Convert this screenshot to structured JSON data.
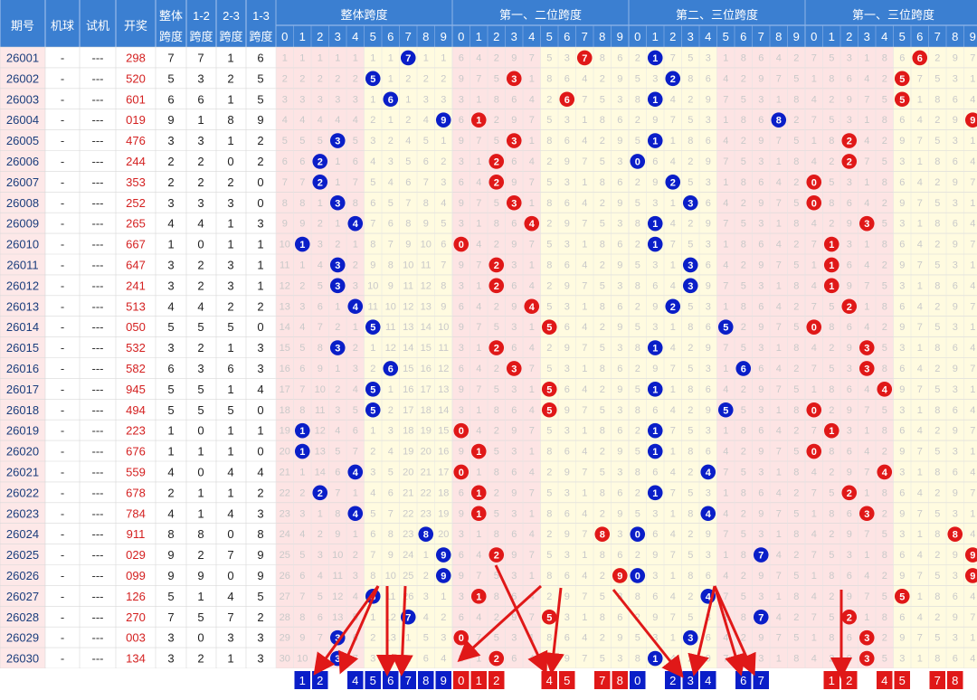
{
  "header": {
    "columns": [
      "期号",
      "机球",
      "试机",
      "开奖",
      "整体跨度",
      "1-2跨度",
      "2-3跨度",
      "1-3跨度"
    ],
    "groups": [
      "整体跨度",
      "第一、二位跨度",
      "第二、三位跨度",
      "第一、三位跨度"
    ],
    "digits": [
      "0",
      "1",
      "2",
      "3",
      "4",
      "5",
      "6",
      "7",
      "8",
      "9"
    ]
  },
  "rows": [
    {
      "issue": "26001",
      "machine": "-",
      "trial": "---",
      "draw": "298",
      "overall": 7,
      "s12": 7,
      "s23": 1,
      "s13": 6
    },
    {
      "issue": "26002",
      "machine": "-",
      "trial": "---",
      "draw": "520",
      "overall": 5,
      "s12": 3,
      "s23": 2,
      "s13": 5
    },
    {
      "issue": "26003",
      "machine": "-",
      "trial": "---",
      "draw": "601",
      "overall": 6,
      "s12": 6,
      "s23": 1,
      "s13": 5
    },
    {
      "issue": "26004",
      "machine": "-",
      "trial": "---",
      "draw": "019",
      "overall": 9,
      "s12": 1,
      "s23": 8,
      "s13": 9
    },
    {
      "issue": "26005",
      "machine": "-",
      "trial": "---",
      "draw": "476",
      "overall": 3,
      "s12": 3,
      "s23": 1,
      "s13": 2
    },
    {
      "issue": "26006",
      "machine": "-",
      "trial": "---",
      "draw": "244",
      "overall": 2,
      "s12": 2,
      "s23": 0,
      "s13": 2
    },
    {
      "issue": "26007",
      "machine": "-",
      "trial": "---",
      "draw": "353",
      "overall": 2,
      "s12": 2,
      "s23": 2,
      "s13": 0
    },
    {
      "issue": "26008",
      "machine": "-",
      "trial": "---",
      "draw": "252",
      "overall": 3,
      "s12": 3,
      "s23": 3,
      "s13": 0
    },
    {
      "issue": "26009",
      "machine": "-",
      "trial": "---",
      "draw": "265",
      "overall": 4,
      "s12": 4,
      "s23": 1,
      "s13": 3
    },
    {
      "issue": "26010",
      "machine": "-",
      "trial": "---",
      "draw": "667",
      "overall": 1,
      "s12": 0,
      "s23": 1,
      "s13": 1
    },
    {
      "issue": "26011",
      "machine": "-",
      "trial": "---",
      "draw": "647",
      "overall": 3,
      "s12": 2,
      "s23": 3,
      "s13": 1
    },
    {
      "issue": "26012",
      "machine": "-",
      "trial": "---",
      "draw": "241",
      "overall": 3,
      "s12": 2,
      "s23": 3,
      "s13": 1
    },
    {
      "issue": "26013",
      "machine": "-",
      "trial": "---",
      "draw": "513",
      "overall": 4,
      "s12": 4,
      "s23": 2,
      "s13": 2
    },
    {
      "issue": "26014",
      "machine": "-",
      "trial": "---",
      "draw": "050",
      "overall": 5,
      "s12": 5,
      "s23": 5,
      "s13": 0
    },
    {
      "issue": "26015",
      "machine": "-",
      "trial": "---",
      "draw": "532",
      "overall": 3,
      "s12": 2,
      "s23": 1,
      "s13": 3
    },
    {
      "issue": "26016",
      "machine": "-",
      "trial": "---",
      "draw": "582",
      "overall": 6,
      "s12": 3,
      "s23": 6,
      "s13": 3
    },
    {
      "issue": "26017",
      "machine": "-",
      "trial": "---",
      "draw": "945",
      "overall": 5,
      "s12": 5,
      "s23": 1,
      "s13": 4
    },
    {
      "issue": "26018",
      "machine": "-",
      "trial": "---",
      "draw": "494",
      "overall": 5,
      "s12": 5,
      "s23": 5,
      "s13": 0
    },
    {
      "issue": "26019",
      "machine": "-",
      "trial": "---",
      "draw": "223",
      "overall": 1,
      "s12": 0,
      "s23": 1,
      "s13": 1
    },
    {
      "issue": "26020",
      "machine": "-",
      "trial": "---",
      "draw": "676",
      "overall": 1,
      "s12": 1,
      "s23": 1,
      "s13": 0
    },
    {
      "issue": "26021",
      "machine": "-",
      "trial": "---",
      "draw": "559",
      "overall": 4,
      "s12": 0,
      "s23": 4,
      "s13": 4
    },
    {
      "issue": "26022",
      "machine": "-",
      "trial": "---",
      "draw": "678",
      "overall": 2,
      "s12": 1,
      "s23": 1,
      "s13": 2
    },
    {
      "issue": "26023",
      "machine": "-",
      "trial": "---",
      "draw": "784",
      "overall": 4,
      "s12": 1,
      "s23": 4,
      "s13": 3
    },
    {
      "issue": "26024",
      "machine": "-",
      "trial": "---",
      "draw": "911",
      "overall": 8,
      "s12": 8,
      "s23": 0,
      "s13": 8
    },
    {
      "issue": "26025",
      "machine": "-",
      "trial": "---",
      "draw": "029",
      "overall": 9,
      "s12": 2,
      "s23": 7,
      "s13": 9
    },
    {
      "issue": "26026",
      "machine": "-",
      "trial": "---",
      "draw": "099",
      "overall": 9,
      "s12": 9,
      "s23": 0,
      "s13": 9
    },
    {
      "issue": "26027",
      "machine": "-",
      "trial": "---",
      "draw": "126",
      "overall": 5,
      "s12": 1,
      "s23": 4,
      "s13": 5
    },
    {
      "issue": "26028",
      "machine": "-",
      "trial": "---",
      "draw": "270",
      "overall": 7,
      "s12": 5,
      "s23": 7,
      "s13": 2
    },
    {
      "issue": "26029",
      "machine": "-",
      "trial": "---",
      "draw": "003",
      "overall": 3,
      "s12": 0,
      "s23": 3,
      "s13": 3
    },
    {
      "issue": "26030",
      "machine": "-",
      "trial": "---",
      "draw": "134",
      "overall": 3,
      "s12": 2,
      "s23": 1,
      "s13": 3
    }
  ],
  "missing": {
    "overall": [
      [
        "1",
        "1",
        "1",
        "1",
        "1",
        "1",
        "1",
        "7",
        "1",
        "1"
      ],
      [
        "2",
        "2",
        "2",
        "2",
        "2",
        "5",
        "1",
        "2",
        "2",
        "2"
      ],
      [
        "3",
        "3",
        "3",
        "3",
        "3",
        "1",
        "6",
        "1",
        "3",
        "3"
      ],
      [
        "4",
        "4",
        "4",
        "4",
        "4",
        "2",
        "1",
        "2",
        "4",
        "9"
      ],
      [
        "5",
        "5",
        "5",
        "3",
        "5",
        "3",
        "2",
        "4",
        "5",
        "1"
      ],
      [
        "6",
        "6",
        "2",
        "1",
        "6",
        "4",
        "3",
        "5",
        "6",
        "2"
      ],
      [
        "7",
        "7",
        "2",
        "1",
        "7",
        "5",
        "4",
        "6",
        "7",
        "3"
      ],
      [
        "8",
        "8",
        "1",
        "3",
        "8",
        "6",
        "5",
        "7",
        "8",
        "4"
      ],
      [
        "9",
        "9",
        "2",
        "1",
        "4",
        "7",
        "6",
        "8",
        "9",
        "5"
      ],
      [
        "10",
        "1",
        "3",
        "2",
        "1",
        "8",
        "7",
        "9",
        "10",
        "6"
      ],
      [
        "11",
        "1",
        "4",
        "3",
        "2",
        "9",
        "8",
        "10",
        "11",
        "7"
      ],
      [
        "12",
        "2",
        "5",
        "3",
        "3",
        "10",
        "9",
        "11",
        "12",
        "8"
      ],
      [
        "13",
        "3",
        "6",
        "1",
        "4",
        "11",
        "10",
        "12",
        "13",
        "9"
      ],
      [
        "14",
        "4",
        "7",
        "2",
        "1",
        "5",
        "11",
        "13",
        "14",
        "10"
      ],
      [
        "15",
        "5",
        "8",
        "3",
        "2",
        "1",
        "12",
        "14",
        "15",
        "11"
      ],
      [
        "16",
        "6",
        "9",
        "1",
        "3",
        "2",
        "6",
        "15",
        "16",
        "12"
      ],
      [
        "17",
        "7",
        "10",
        "2",
        "4",
        "5",
        "1",
        "16",
        "17",
        "13"
      ],
      [
        "18",
        "8",
        "11",
        "3",
        "5",
        "5",
        "2",
        "17",
        "18",
        "14"
      ],
      [
        "19",
        "1",
        "12",
        "4",
        "6",
        "1",
        "3",
        "18",
        "19",
        "15"
      ],
      [
        "20",
        "1",
        "13",
        "5",
        "7",
        "2",
        "4",
        "19",
        "20",
        "16"
      ],
      [
        "21",
        "1",
        "14",
        "6",
        "4",
        "3",
        "5",
        "20",
        "21",
        "17"
      ],
      [
        "22",
        "2",
        "2",
        "7",
        "1",
        "4",
        "6",
        "21",
        "22",
        "18"
      ],
      [
        "23",
        "3",
        "1",
        "8",
        "4",
        "5",
        "7",
        "22",
        "23",
        "19"
      ],
      [
        "24",
        "4",
        "2",
        "9",
        "1",
        "6",
        "8",
        "23",
        "8",
        "20"
      ],
      [
        "25",
        "5",
        "3",
        "10",
        "2",
        "7",
        "9",
        "24",
        "1",
        "9"
      ],
      [
        "26",
        "6",
        "4",
        "11",
        "3",
        "8",
        "10",
        "25",
        "2",
        "9"
      ],
      [
        "27",
        "7",
        "5",
        "12",
        "4",
        "5",
        "11",
        "26",
        "3",
        "1"
      ],
      [
        "28",
        "8",
        "6",
        "13",
        "5",
        "1",
        "12",
        "7",
        "4",
        "2"
      ],
      [
        "29",
        "9",
        "7",
        "3",
        "6",
        "2",
        "13",
        "1",
        "5",
        "3"
      ],
      [
        "30",
        "10",
        "8",
        "3",
        "7",
        "3",
        "14",
        "2",
        "6",
        "4"
      ]
    ]
  },
  "balls": {
    "overall_color": "#0a1ec8",
    "pair_color": "#e01818",
    "s23_color": "#0a1ec8",
    "s13_color": "#e01818"
  },
  "bottom": {
    "overall": [
      "",
      "1",
      "2",
      "",
      "4",
      "5",
      "6",
      "7",
      "8",
      "9"
    ],
    "s12": [
      "0",
      "1",
      "2",
      "",
      "",
      "4",
      "5",
      "",
      "7",
      "8",
      "9"
    ],
    "s23": [
      "0",
      "",
      "2",
      "3",
      "4",
      "",
      "6",
      "7",
      "",
      ""
    ],
    "s13": [
      "",
      "1",
      "2",
      "",
      "4",
      "5",
      "",
      "7",
      "8",
      ""
    ]
  },
  "colors": {
    "header_bg": "#3b7fd1",
    "issue_bg": "#fde8e8",
    "yellow_bg": "#fffbe0",
    "pink_bg": "#fde4e4",
    "blue_bottom": "#0a1ec8",
    "red_bottom": "#e01818",
    "arrow": "#e01818"
  }
}
